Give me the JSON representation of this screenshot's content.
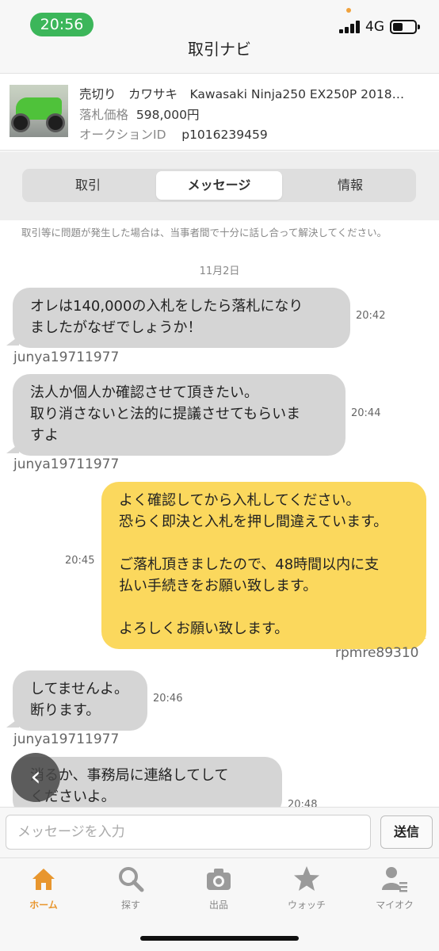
{
  "status": {
    "time": "20:56",
    "network": "4G"
  },
  "nav": {
    "title": "取引ナビ"
  },
  "item": {
    "title": "売切り　カワサキ　Kawasaki Ninja250 EX250P 2018…",
    "price_label": "落札価格",
    "price": "598,000円",
    "auction_label": "オークションID",
    "auction_id": "p1016239459"
  },
  "tabs": [
    {
      "label": "取引",
      "active": false
    },
    {
      "label": "メッセージ",
      "active": true
    },
    {
      "label": "情報",
      "active": false
    }
  ],
  "messages_area": {
    "notice": "取引等に問題が発生した場合は、当事者間で十分に話し合って解決してください。",
    "date": "11月2日"
  },
  "messages": [
    {
      "dir": "in",
      "text": "オレは140,000の入札をしたら落札になり\nましたがなぜでしょうか！",
      "time": "20:42",
      "user": "junya19711977"
    },
    {
      "dir": "in",
      "text": "法人か個人か確認させて頂きたい。\n取り消さないと法的に提議させてもらいま\nすよ",
      "time": "20:44",
      "user": "junya19711977"
    },
    {
      "dir": "out",
      "text": "よく確認してから入札してください。\n恐らく即決と入札を押し間違えています。\n\nご落札頂きましたので、48時間以内に支\n払い手続きをお願い致します。\n\nよろしくお願い致します。",
      "time": "20:45",
      "user": "rpmre89310"
    },
    {
      "dir": "in",
      "text": "してませんよ。\n断ります。",
      "time": "20:46",
      "user": "junya19711977"
    },
    {
      "dir": "in",
      "text": "消るか、事務局に連絡してして\nくださいよ。",
      "time": "20:48",
      "user": ""
    }
  ],
  "input": {
    "placeholder": "メッセージを入力",
    "value": ""
  },
  "send_label": "送信",
  "tabbar": [
    {
      "label": "ホーム",
      "icon": "home-icon",
      "active": true
    },
    {
      "label": "探す",
      "icon": "search-icon",
      "active": false
    },
    {
      "label": "出品",
      "icon": "camera-icon",
      "active": false
    },
    {
      "label": "ウォッチ",
      "icon": "star-icon",
      "active": false
    },
    {
      "label": "マイオク",
      "icon": "user-list-icon",
      "active": false
    }
  ],
  "colors": {
    "accent": "#e8962e",
    "outgoing_bubble": "#fbd85d",
    "incoming_bubble": "#d5d5d5",
    "status_pill": "#3cb65a"
  }
}
